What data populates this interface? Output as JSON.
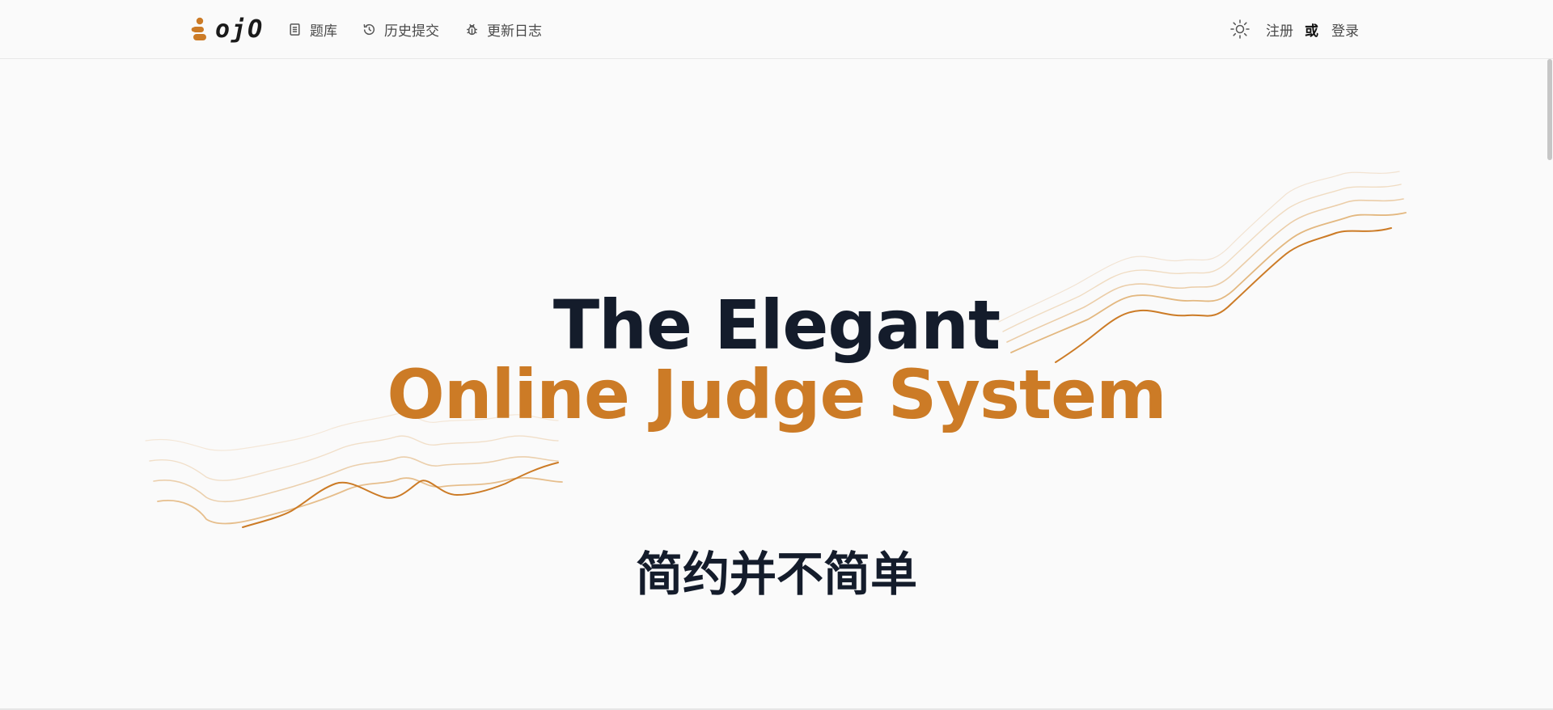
{
  "brand": {
    "name": "ojO",
    "accent_color": "#cc7b26"
  },
  "nav": {
    "items": [
      {
        "label": "题库",
        "icon": "document-list-icon"
      },
      {
        "label": "历史提交",
        "icon": "history-icon"
      },
      {
        "label": "更新日志",
        "icon": "bug-icon"
      }
    ]
  },
  "header_right": {
    "theme_icon": "sun-icon",
    "register_label": "注册",
    "or_label": "或",
    "login_label": "登录"
  },
  "hero": {
    "title_line1": "The Elegant",
    "title_line2": "Online Judge System",
    "slogan": "简约并不简单",
    "title_color": "#141c2b",
    "highlight_color": "#cc7b26"
  }
}
